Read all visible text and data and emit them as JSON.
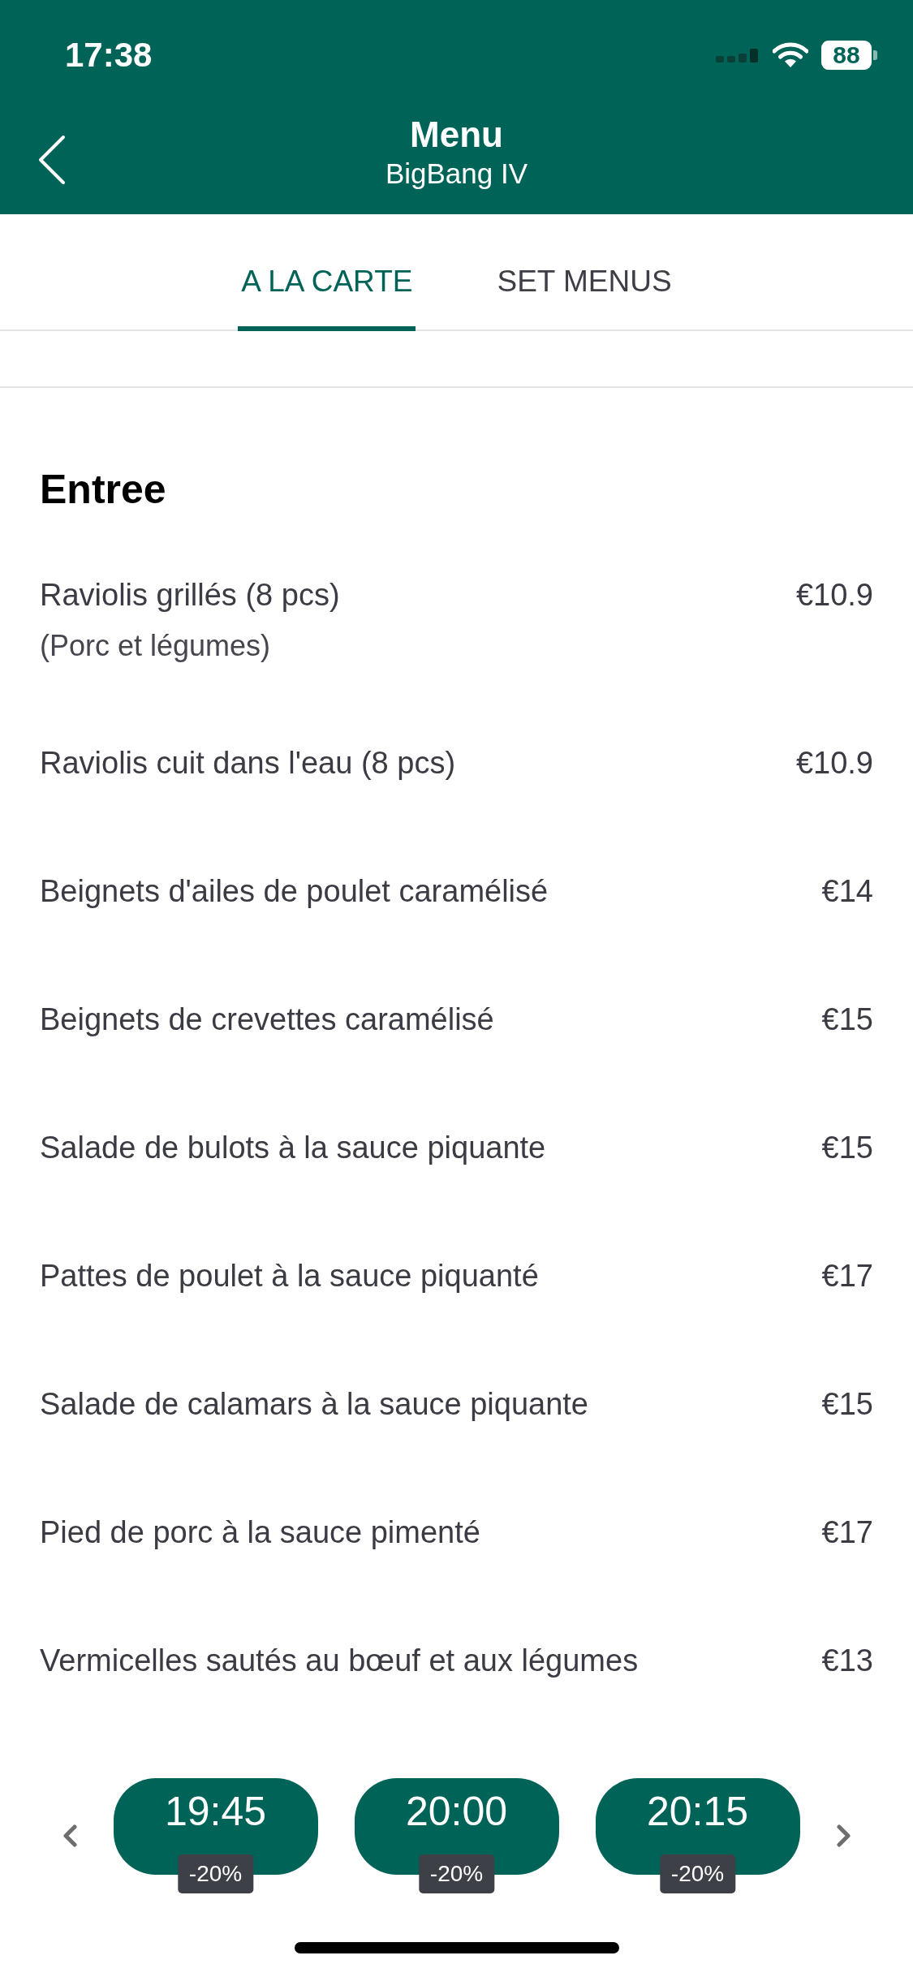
{
  "status_bar": {
    "time": "17:38",
    "battery": "88"
  },
  "header": {
    "title": "Menu",
    "subtitle": "BigBang IV"
  },
  "tabs": [
    {
      "label": "A LA CARTE",
      "selected": true
    },
    {
      "label": "SET MENUS",
      "selected": false
    }
  ],
  "sections": [
    {
      "title": "Entree",
      "items": [
        {
          "name": "Raviolis grillés (8 pcs)",
          "description": "(Porc et légumes)",
          "price": "€10.9"
        },
        {
          "name": "Raviolis cuit dans l'eau (8 pcs)",
          "price": "€10.9"
        },
        {
          "name": "Beignets d'ailes de poulet caramélisé",
          "price": "€14"
        },
        {
          "name": "Beignets de crevettes caramélisé",
          "price": "€15"
        },
        {
          "name": "Salade de bulots à la sauce piquante",
          "price": "€15"
        },
        {
          "name": "Pattes de poulet à la sauce piquanté",
          "price": "€17"
        },
        {
          "name": "Salade de calamars à la sauce piquante",
          "price": "€15"
        },
        {
          "name": "Pied de porc à la sauce pimenté",
          "price": "€17"
        },
        {
          "name": "Vermicelles sautés au bœuf et aux légumes",
          "price": "€13"
        }
      ]
    }
  ],
  "time_slots": [
    {
      "time": "19:45",
      "discount": "-20%"
    },
    {
      "time": "20:00",
      "discount": "-20%"
    },
    {
      "time": "20:15",
      "discount": "-20%"
    }
  ]
}
